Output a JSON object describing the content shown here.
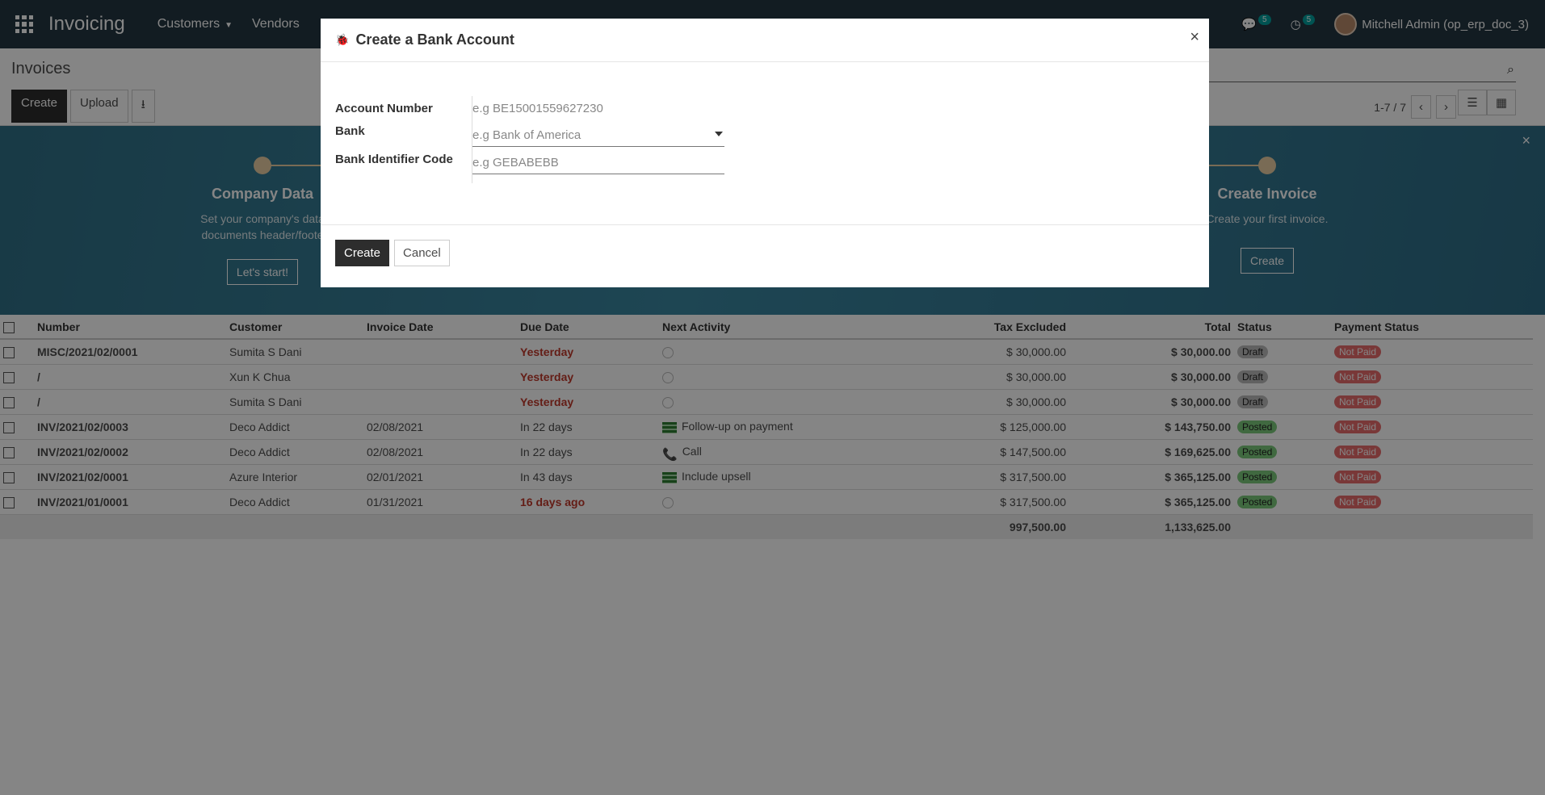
{
  "navbar": {
    "app_title": "Invoicing",
    "menu": [
      {
        "label": "Customers",
        "dropdown": true
      },
      {
        "label": "Vendors",
        "dropdown": false
      }
    ],
    "messages_count": "5",
    "activities_count": "5",
    "user": "Mitchell Admin (op_erp_doc_3)"
  },
  "control_panel": {
    "breadcrumb": "Invoices",
    "create_label": "Create",
    "upload_label": "Upload",
    "pager": "1-7 / 7"
  },
  "banner": {
    "steps": [
      {
        "title": "Company Data",
        "desc_line1": "Set your company's data",
        "desc_line2": "documents header/foote",
        "button": "Let's start!"
      },
      {
        "title": "Create Invoice",
        "desc_line1": "Create your first invoice.",
        "desc_line2": "",
        "button": "Create"
      }
    ]
  },
  "table": {
    "headers": [
      "Number",
      "Customer",
      "Invoice Date",
      "Due Date",
      "Next Activity",
      "Tax Excluded",
      "Total",
      "Status",
      "Payment Status"
    ],
    "rows": [
      {
        "number": "MISC/2021/02/0001",
        "customer": "Sumita S Dani",
        "invoice_date": "",
        "due_date": "Yesterday",
        "due_red": true,
        "activity": "",
        "activity_type": "clock",
        "tax_excluded": "$ 30,000.00",
        "total": "$ 30,000.00",
        "status": "Draft",
        "payment": "Not Paid"
      },
      {
        "number": "/",
        "customer": "Xun K Chua",
        "invoice_date": "",
        "due_date": "Yesterday",
        "due_red": true,
        "activity": "",
        "activity_type": "clock",
        "tax_excluded": "$ 30,000.00",
        "total": "$ 30,000.00",
        "status": "Draft",
        "payment": "Not Paid"
      },
      {
        "number": "/",
        "customer": "Sumita S Dani",
        "invoice_date": "",
        "due_date": "Yesterday",
        "due_red": true,
        "activity": "",
        "activity_type": "clock",
        "tax_excluded": "$ 30,000.00",
        "total": "$ 30,000.00",
        "status": "Draft",
        "payment": "Not Paid"
      },
      {
        "number": "INV/2021/02/0003",
        "customer": "Deco Addict",
        "invoice_date": "02/08/2021",
        "due_date": "In 22 days",
        "due_red": false,
        "activity": "Follow-up on payment",
        "activity_type": "money",
        "tax_excluded": "$ 125,000.00",
        "total": "$ 143,750.00",
        "status": "Posted",
        "payment": "Not Paid"
      },
      {
        "number": "INV/2021/02/0002",
        "customer": "Deco Addict",
        "invoice_date": "02/08/2021",
        "due_date": "In 22 days",
        "due_red": false,
        "activity": "Call",
        "activity_type": "call",
        "tax_excluded": "$ 147,500.00",
        "total": "$ 169,625.00",
        "status": "Posted",
        "payment": "Not Paid"
      },
      {
        "number": "INV/2021/02/0001",
        "customer": "Azure Interior",
        "invoice_date": "02/01/2021",
        "due_date": "In 43 days",
        "due_red": false,
        "activity": "Include upsell",
        "activity_type": "money",
        "tax_excluded": "$ 317,500.00",
        "total": "$ 365,125.00",
        "status": "Posted",
        "payment": "Not Paid"
      },
      {
        "number": "INV/2021/01/0001",
        "customer": "Deco Addict",
        "invoice_date": "01/31/2021",
        "due_date": "16 days ago",
        "due_red": true,
        "activity": "",
        "activity_type": "clock",
        "tax_excluded": "$ 317,500.00",
        "total": "$ 365,125.00",
        "status": "Posted",
        "payment": "Not Paid"
      }
    ],
    "totals": {
      "tax_excluded": "997,500.00",
      "total": "1,133,625.00"
    }
  },
  "modal": {
    "title": "Create a Bank Account",
    "account_number_label": "Account Number",
    "account_number_placeholder": "e.g BE15001559627230",
    "bank_label": "Bank",
    "bank_placeholder": "e.g Bank of America",
    "bic_label": "Bank Identifier Code",
    "bic_placeholder": "e.g GEBABEBB",
    "create_label": "Create",
    "cancel_label": "Cancel"
  },
  "colors": {
    "navbar": "#243742",
    "banner": "#3a86a0",
    "primary_button": "#2d2d2d",
    "danger": "#c0392b",
    "posted_badge": "#7bc97b",
    "notpaid_badge": "#e86b6b"
  }
}
